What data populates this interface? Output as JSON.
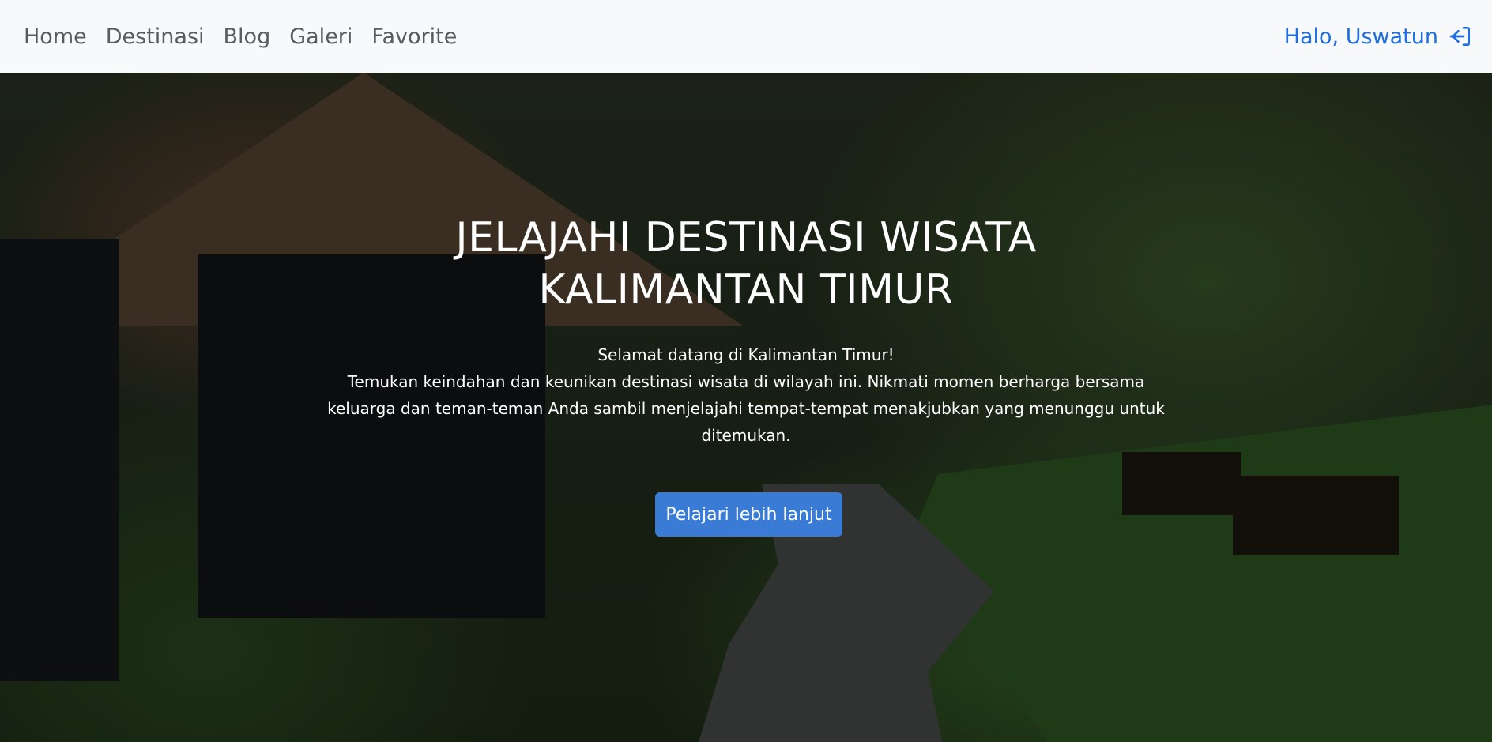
{
  "nav": {
    "links": [
      "Home",
      "Destinasi",
      "Blog",
      "Galeri",
      "Favorite"
    ],
    "greeting": "Halo, Uswatun",
    "logout_icon": "logout-icon",
    "link_color": "#595c5f",
    "greeting_color": "#1f6fe0"
  },
  "hero": {
    "title": "JELAJAHI DESTINASI WISATA KALIMANTAN TIMUR",
    "welcome": "Selamat datang di Kalimantan Timur!",
    "description": "Temukan keindahan dan keunikan destinasi wisata di wilayah ini. Nikmati momen berharga bersama keluarga dan teman-teman Anda sambil menjelajahi tempat-tempat menakjubkan yang menunggu untuk ditemukan.",
    "button_label": "Pelajari lebih lanjut",
    "button_color": "#3a7bd5"
  }
}
